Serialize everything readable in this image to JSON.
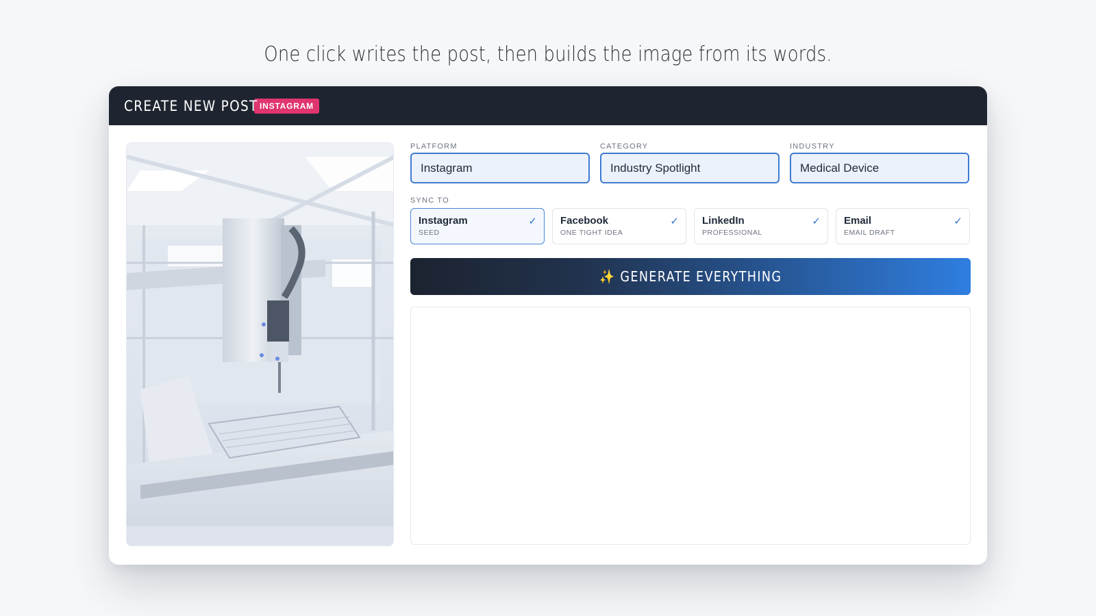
{
  "headline": "One click writes the post, then builds the image from its words.",
  "card": {
    "title": "CREATE NEW POST",
    "badge": "INSTAGRAM"
  },
  "photo": {
    "description_icon": "lab-robot-photo"
  },
  "fields": {
    "platform": {
      "label": "PLATFORM",
      "value": "Instagram"
    },
    "category": {
      "label": "CATEGORY",
      "value": "Industry Spotlight"
    },
    "industry": {
      "label": "INDUSTRY",
      "value": "Medical Device"
    }
  },
  "sync": {
    "label": "SYNC TO",
    "items": [
      {
        "name": "Instagram",
        "sub": "SEED",
        "checked": true
      },
      {
        "name": "Facebook",
        "sub": "ONE TIGHT IDEA",
        "checked": true
      },
      {
        "name": "LinkedIn",
        "sub": "PROFESSIONAL",
        "checked": true
      },
      {
        "name": "Email",
        "sub": "EMAIL DRAFT",
        "checked": true
      }
    ],
    "check_glyph": "✓"
  },
  "generate": {
    "icon": "✨",
    "label": "GENERATE EVERYTHING"
  },
  "colors": {
    "header_bg": "#1f2530",
    "badge": "#e0356f",
    "accent": "#3d7bd1",
    "button_start": "#1c2330",
    "button_end": "#2f7ee0"
  }
}
